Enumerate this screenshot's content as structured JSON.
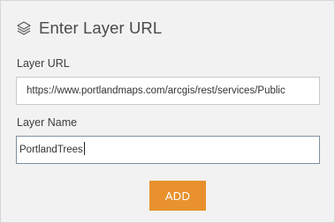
{
  "dialog": {
    "title": "Enter Layer URL",
    "icon": "layers-icon"
  },
  "layer_url": {
    "label": "Layer URL",
    "value": "https://www.portlandmaps.com/arcgis/rest/services/Public"
  },
  "layer_name": {
    "label": "Layer Name",
    "value": "PortlandTrees"
  },
  "actions": {
    "add_label": "ADD"
  },
  "colors": {
    "panel_background": "#f2f2f2",
    "accent_button": "#e8912d",
    "focused_border": "#7f8fa0"
  }
}
